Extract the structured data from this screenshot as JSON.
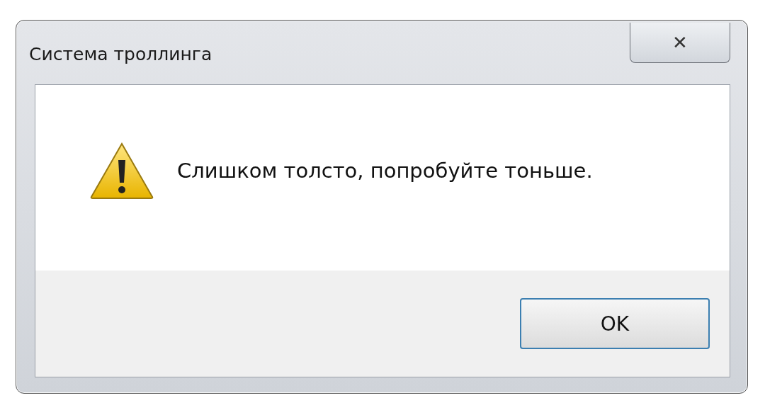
{
  "window": {
    "title": "Система троллинга",
    "close_label": "✕"
  },
  "message": {
    "kind": "warning",
    "text": "Слишком толсто, попробуйте тоньше."
  },
  "buttons": [
    {
      "label": "OK",
      "selected": true
    }
  ]
}
